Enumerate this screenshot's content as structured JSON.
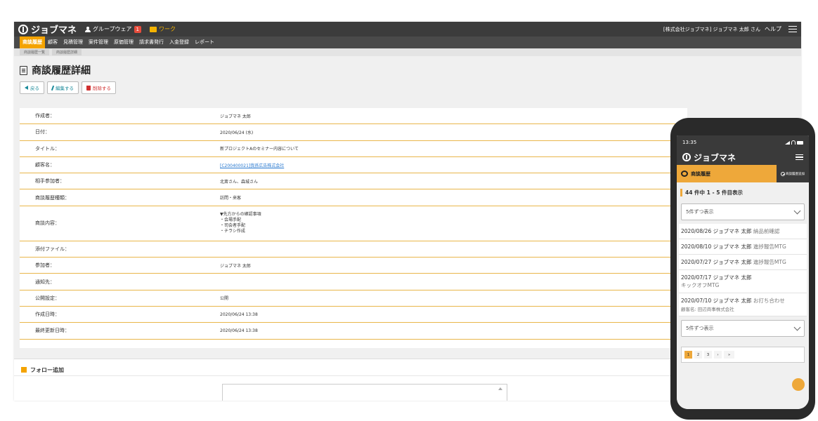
{
  "app": {
    "name": "ジョブマネ",
    "groupware_label": "グループウェア",
    "groupware_badge": "1",
    "work_label": "ワーク",
    "company_user": "[株式会社ジョブマネ] ジョブマネ 太郎 さん",
    "help_label": "ヘルプ"
  },
  "menu": [
    "商談履歴",
    "顧客",
    "見積管理",
    "案件管理",
    "原価管理",
    "請求書発行",
    "入金登録",
    "レポート"
  ],
  "breadcrumb": [
    "商談履歴一覧",
    "商談履歴詳細"
  ],
  "page": {
    "title": "商談履歴詳細",
    "back_label": "戻る",
    "edit_label": "編集する",
    "delete_label": "削除する"
  },
  "details": [
    {
      "label": "作成者：",
      "value": "ジョブマネ 太郎"
    },
    {
      "label": "日付：",
      "value": "2020/06/24 (水)"
    },
    {
      "label": "タイトル：",
      "value": "新プロジェクトAのセミナー内容について"
    },
    {
      "label": "顧客名：",
      "value": "[C200400021]我孫広告株式会社"
    },
    {
      "label": "相手参加者：",
      "value": "北斎さん、森城さん"
    },
    {
      "label": "商談履歴種類：",
      "value": "訪問・来客"
    },
    {
      "label": "商談内容：",
      "value_lines": [
        "▼先方からの確認事項",
        "・会場手配",
        "・司会者手配",
        "・チラシ作成"
      ]
    },
    {
      "label": "添付ファイル：",
      "value": ""
    },
    {
      "label": "参加者：",
      "value": "ジョブマネ 太郎"
    },
    {
      "label": "通知先：",
      "value": ""
    },
    {
      "label": "公開設定：",
      "value": "公開"
    },
    {
      "label": "作成日時：",
      "value": "2020/06/24 13:38"
    },
    {
      "label": "最終更新日時：",
      "value": "2020/06/24 13:38"
    }
  ],
  "follow": {
    "title": "フォロー追加"
  },
  "mobile": {
    "time": "13:35",
    "app_name": "ジョブマネ",
    "tab_label": "商談履歴",
    "add_label": "商談履歴追加",
    "count_text": "44 件中 1 - 5 件目表示",
    "per_page_label": "5件ずつ表示",
    "items": [
      {
        "main": "2020/08/26 ジョブマネ 太郎",
        "sub": "納品前確認",
        "note": ""
      },
      {
        "main": "2020/08/10 ジョブマネ 太郎",
        "sub": "進捗報告MTG",
        "note": ""
      },
      {
        "main": "2020/07/27 ジョブマネ 太郎",
        "sub": "進捗報告MTG",
        "note": ""
      },
      {
        "main": "2020/07/17 ジョブマネ 太郎",
        "sub": "キックオフMTG",
        "note": ""
      },
      {
        "main": "2020/07/10 ジョブマネ 太郎",
        "sub": "お打ち合わせ",
        "note": "顧客名: 田辺商事株式会社"
      }
    ],
    "per_page_label_bottom": "5件ずつ表示",
    "pages": [
      "1",
      "2",
      "3",
      "›",
      "»"
    ]
  },
  "colors": {
    "accent": "#f4a300",
    "header_bg": "#3c3c3c",
    "row_border": "#e9b64a",
    "link": "#2a7ad0"
  }
}
